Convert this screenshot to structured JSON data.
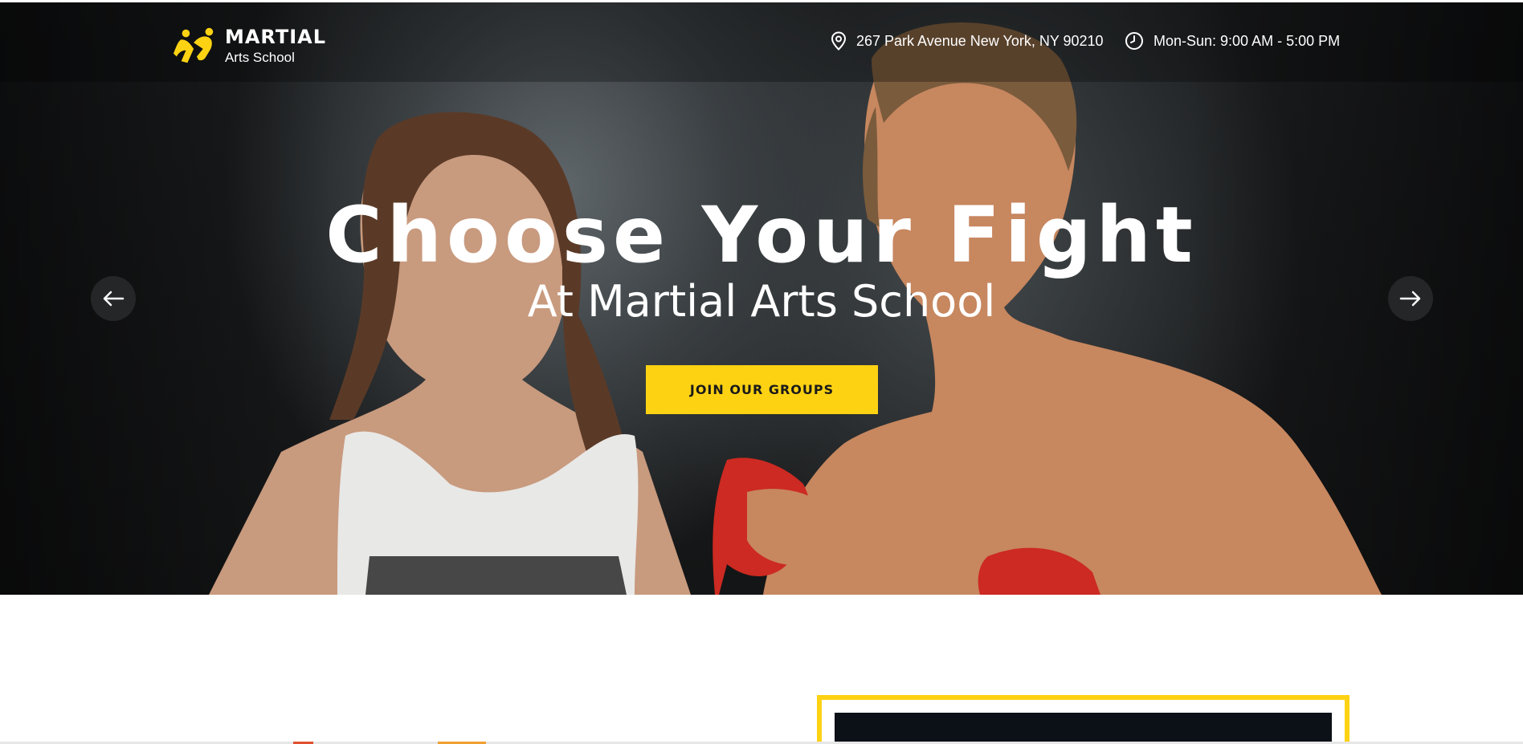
{
  "brand": {
    "name": "MARTIAL",
    "tagline": "Arts School",
    "accent_color": "#fdd213"
  },
  "header": {
    "address": {
      "icon": "map-pin-icon",
      "text": "267 Park Avenue New York, NY 90210"
    },
    "hours": {
      "icon": "clock-icon",
      "text": "Mon-Sun: 9:00 AM - 5:00 PM"
    }
  },
  "hero": {
    "headline": "Choose Your Fight",
    "subheadline": "At Martial Arts School",
    "cta_label": "JOIN OUR GROUPS",
    "prev_icon": "arrow-left-icon",
    "next_icon": "arrow-right-icon"
  }
}
